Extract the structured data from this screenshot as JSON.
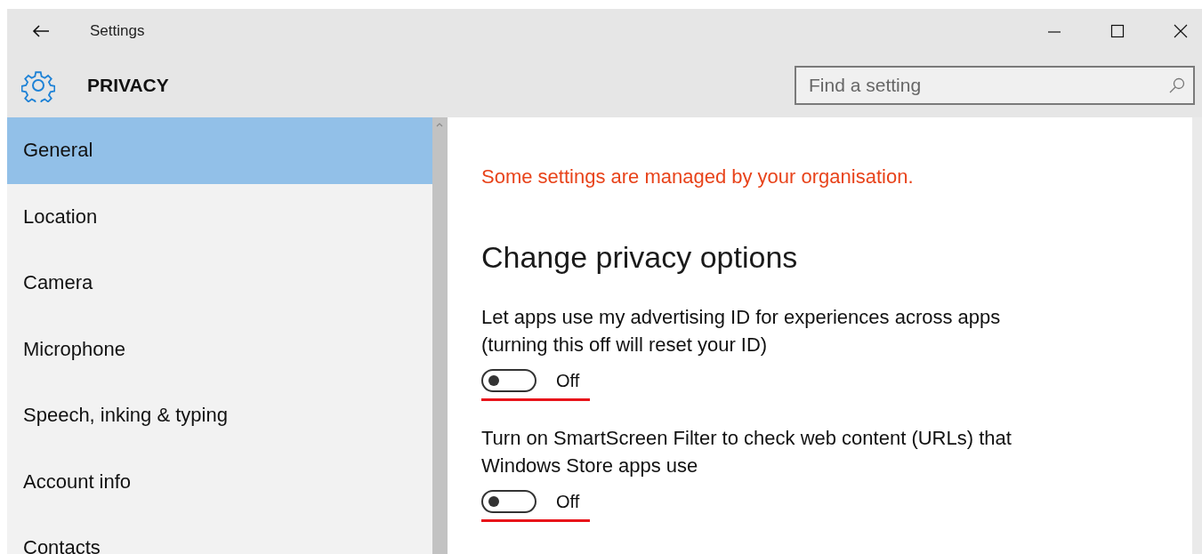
{
  "window": {
    "title": "Settings"
  },
  "header": {
    "title": "PRIVACY"
  },
  "search": {
    "placeholder": "Find a setting"
  },
  "sidebar": {
    "items": [
      {
        "label": "General",
        "selected": true
      },
      {
        "label": "Location",
        "selected": false
      },
      {
        "label": "Camera",
        "selected": false
      },
      {
        "label": "Microphone",
        "selected": false
      },
      {
        "label": "Speech, inking & typing",
        "selected": false
      },
      {
        "label": "Account info",
        "selected": false
      },
      {
        "label": "Contacts",
        "selected": false
      }
    ]
  },
  "content": {
    "notice": "Some settings are managed by your organisation.",
    "heading": "Change privacy options",
    "options": [
      {
        "description": "Let apps use my advertising ID for experiences across apps (turning this off will reset your ID)",
        "on": false,
        "state_label": "Off",
        "underlined": true
      },
      {
        "description": "Turn on SmartScreen Filter to check web content (URLs) that Windows Store apps use",
        "on": false,
        "state_label": "Off",
        "underlined": true
      }
    ]
  }
}
